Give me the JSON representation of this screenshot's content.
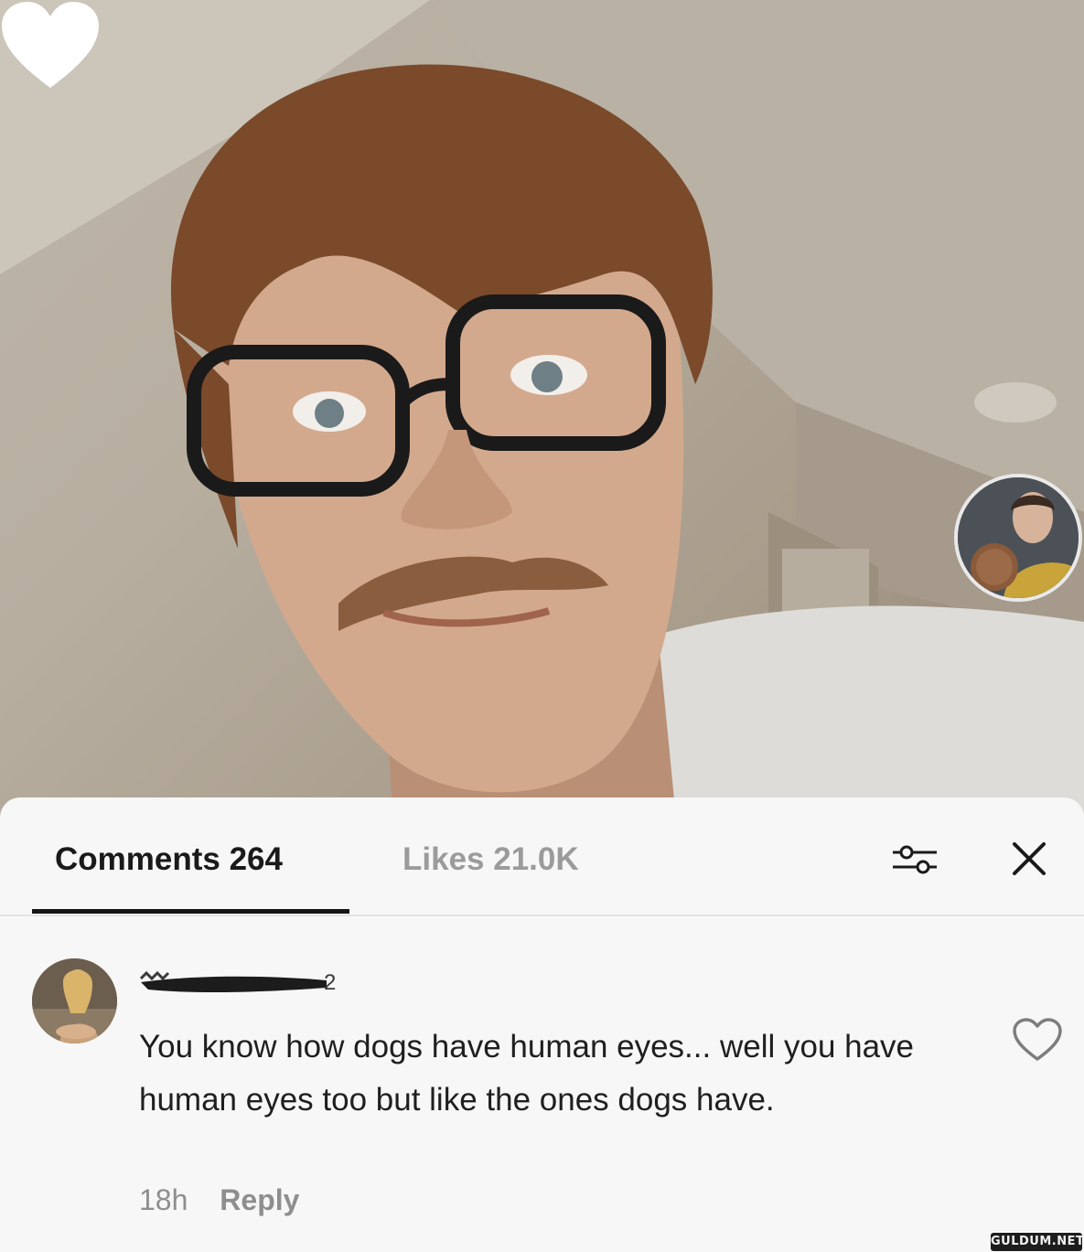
{
  "tabs": {
    "comments_label": "Comments 264",
    "likes_label": "Likes 21.0K",
    "active": "comments"
  },
  "icons": {
    "filter": "sliders-icon",
    "close": "close-icon",
    "video_like": "heart-icon",
    "comment_like": "heart-outline-icon"
  },
  "comment": {
    "text": "You know how dogs have human eyes... well you have human eyes too but like the ones dogs have.",
    "time": "18h",
    "reply_label": "Reply"
  },
  "watermark": {
    "text": "GULDUM.NET"
  },
  "colors": {
    "active_tab": "#1a1a1a",
    "inactive_tab": "#9b9b9b",
    "sheet_bg": "#f7f7f7"
  }
}
